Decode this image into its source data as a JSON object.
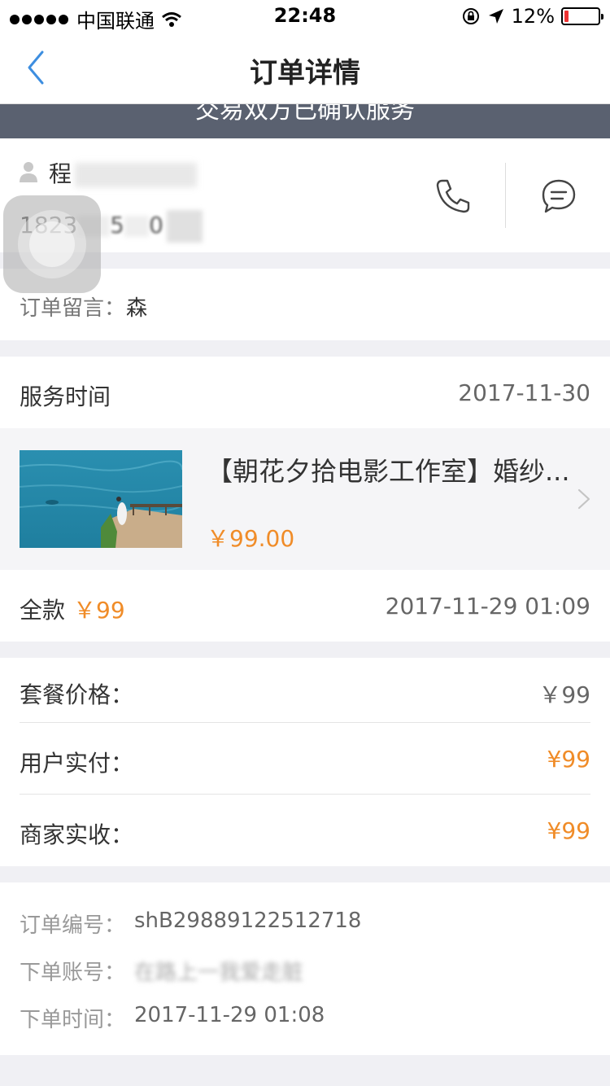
{
  "status_bar": {
    "carrier": "中国联通",
    "time": "22:48",
    "battery": "12%",
    "battery_level": 0.12
  },
  "nav": {
    "title": "订单详情"
  },
  "banner": {
    "text": "交易双方已确认服务"
  },
  "contact": {
    "name": "程",
    "phone": "1823",
    "phone_tail": "5",
    "phone_end": "0"
  },
  "note": {
    "label": "订单留言：",
    "value": "森"
  },
  "service": {
    "label": "服务时间",
    "value": "2017-11-30"
  },
  "product": {
    "name": "【朝花夕拾电影工作室】婚纱...",
    "price": "￥99.00"
  },
  "payment": {
    "label": "全款",
    "amount": "￥99",
    "time": "2017-11-29 01:09"
  },
  "prices": [
    {
      "label": "套餐价格：",
      "value": "￥99"
    },
    {
      "label": "用户实付：",
      "value": "¥99"
    },
    {
      "label": "商家实收：",
      "value": "¥99"
    }
  ],
  "meta": {
    "order_no_label": "订单编号：",
    "order_no": "shB29889122512718",
    "account_label": "下单账号：",
    "account": "在路上一我爱走脏",
    "order_time_label": "下单时间：",
    "order_time": "2017-11-29 01:08"
  }
}
